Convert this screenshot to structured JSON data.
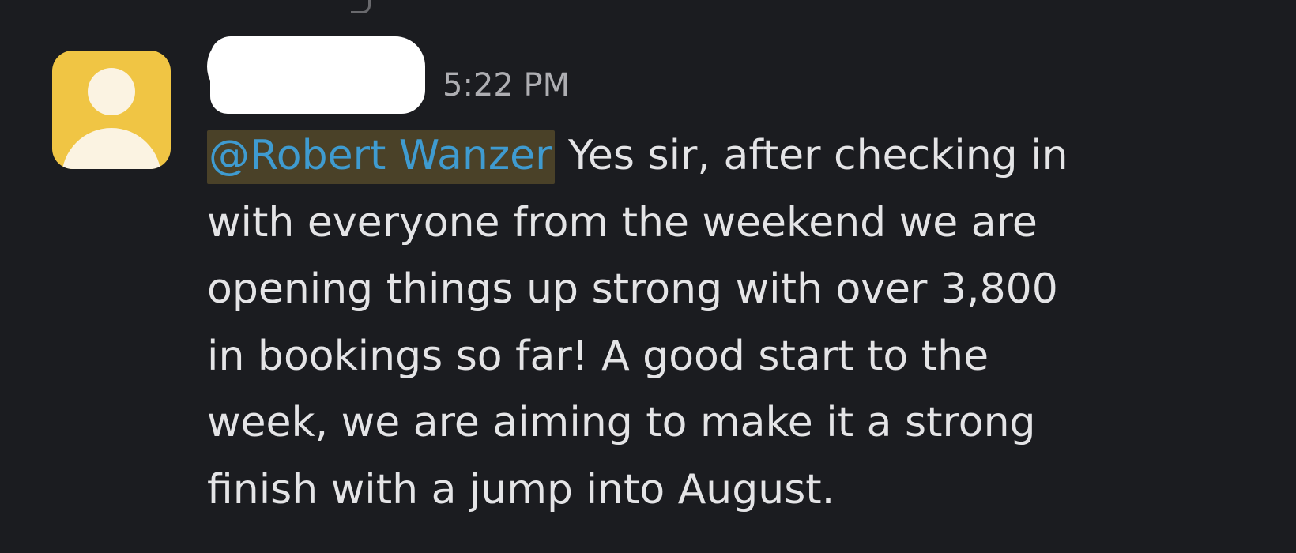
{
  "message": {
    "timestamp": "5:22 PM",
    "mention": "@Robert Wanzer",
    "lines": [
      " Yes sir, after checking in",
      "with everyone from the weekend we are",
      "opening things up strong with over 3,800",
      "in bookings so far! A good start to the",
      "week, we are aiming to make it a strong",
      "finish with a jump into August."
    ]
  },
  "colors": {
    "background": "#1b1c20",
    "avatar": "#f0c544",
    "mention_text": "#3f9bd0",
    "mention_highlight": "#4a4128",
    "message_text": "#e4e4e6",
    "timestamp_text": "#aeaeb2"
  },
  "icons": {
    "avatar": "default-user-avatar-icon"
  }
}
